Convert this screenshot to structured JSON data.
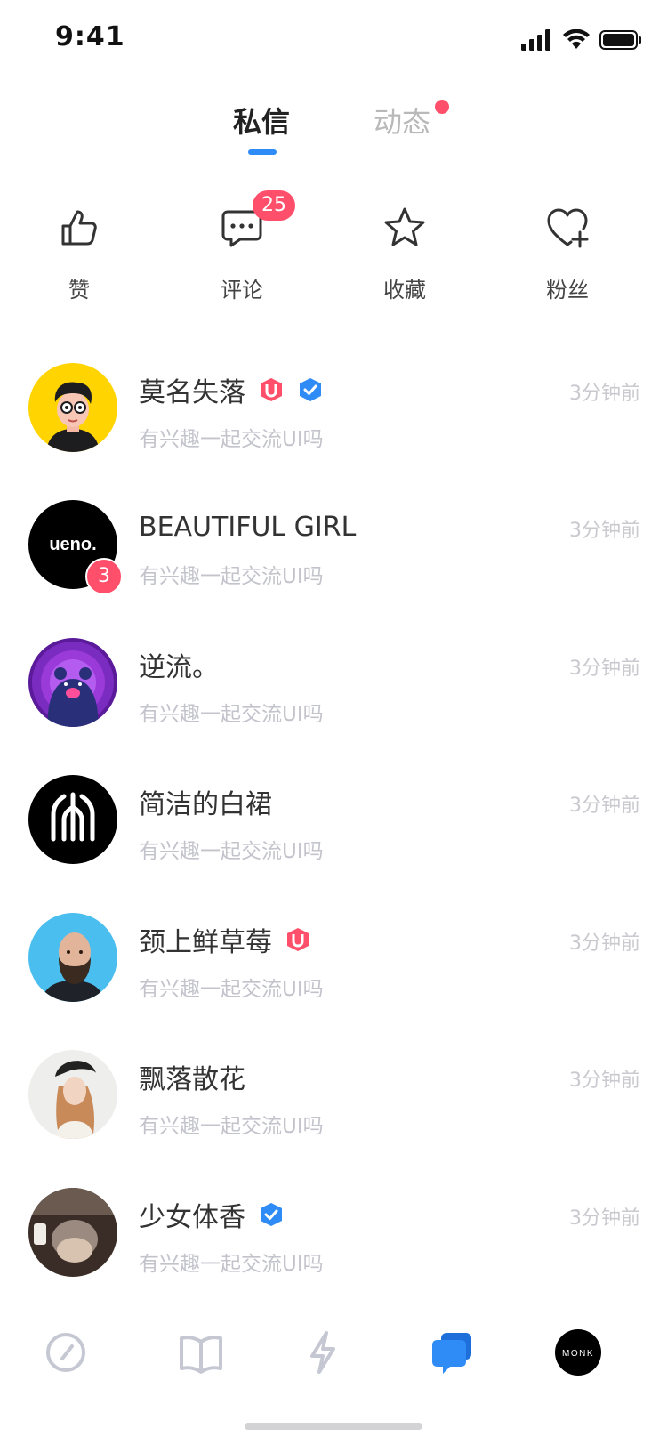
{
  "status_bar": {
    "time": "9:41"
  },
  "tabs": {
    "dm": "私信",
    "activity": "动态"
  },
  "quick_actions": [
    {
      "label": "赞",
      "icon": "thumbs-up-icon"
    },
    {
      "label": "评论",
      "icon": "comment-icon",
      "badge": "25"
    },
    {
      "label": "收藏",
      "icon": "star-icon"
    },
    {
      "label": "粉丝",
      "icon": "heart-plus-icon"
    }
  ],
  "messages": [
    {
      "name": "莫名失落",
      "preview": "有兴趣一起交流UI吗",
      "time": "3分钟前",
      "badges": [
        "u-badge",
        "verified-badge"
      ]
    },
    {
      "name": "BEAUTIFUL GIRL",
      "preview": "有兴趣一起交流UI吗",
      "time": "3分钟前",
      "unread": "3",
      "avatar_text": "ueno."
    },
    {
      "name": "逆流。",
      "preview": "有兴趣一起交流UI吗",
      "time": "3分钟前"
    },
    {
      "name": "简洁的白裙",
      "preview": "有兴趣一起交流UI吗",
      "time": "3分钟前"
    },
    {
      "name": "颈上鲜草莓",
      "preview": "有兴趣一起交流UI吗",
      "time": "3分钟前",
      "badges": [
        "u-badge"
      ]
    },
    {
      "name": "飘落散花",
      "preview": "有兴趣一起交流UI吗",
      "time": "3分钟前"
    },
    {
      "name": "少女体香",
      "preview": "有兴趣一起交流UI吗",
      "time": "3分钟前",
      "badges": [
        "verified-badge"
      ]
    }
  ],
  "tabbar": {
    "items": [
      "compass-icon",
      "book-icon",
      "lightning-icon",
      "messages-icon",
      "profile-avatar"
    ],
    "active": "messages-icon",
    "avatar_text": "MONK"
  },
  "colors": {
    "accent": "#2f8cf7",
    "badge": "#ff4f6a",
    "muted": "#c3c3cc"
  }
}
